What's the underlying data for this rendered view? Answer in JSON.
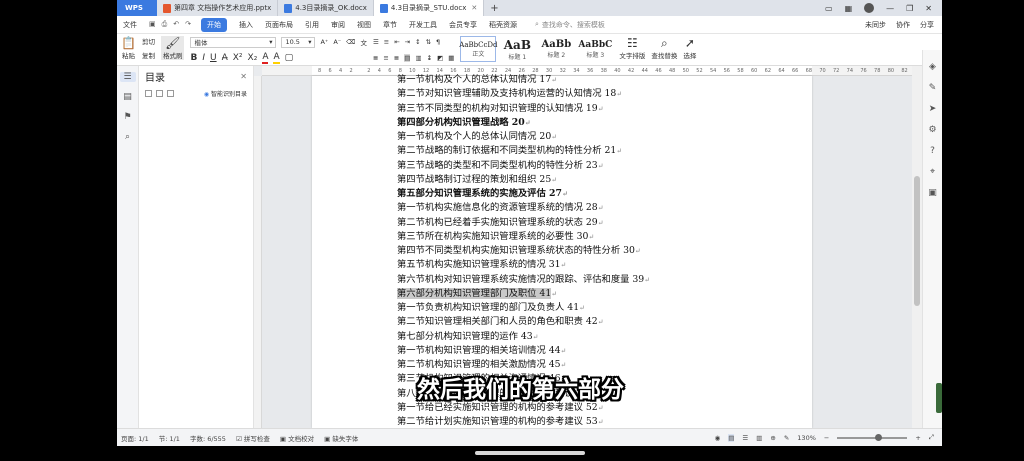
{
  "titlebar": {
    "app": "WPS",
    "tabs": [
      {
        "label": "第四章 文档操作艺术应用.pptx",
        "type": "ppt"
      },
      {
        "label": "4.3目录摘录_OK.docx",
        "type": "doc"
      },
      {
        "label": "4.3目录摘录_STU.docx",
        "type": "doc",
        "active": true
      }
    ],
    "plus": "+"
  },
  "menubar": {
    "file": "文件",
    "items": [
      "开始",
      "插入",
      "页面布局",
      "引用",
      "审阅",
      "视图",
      "章节",
      "开发工具",
      "会员专享",
      "稻壳资源"
    ],
    "active_index": 0,
    "search_placeholder": "查找命令、搜索模板",
    "right": [
      "未同步",
      "协作",
      "分享"
    ]
  },
  "toolbar": {
    "paste": "粘贴",
    "cut": "剪切",
    "copy": "复制",
    "format_painter": "格式刷",
    "font": "楷体",
    "size": "10.5",
    "bold": "B",
    "italic": "I",
    "underline": "U",
    "styles": [
      {
        "sample": "AaBbCcDd",
        "name": "正文"
      },
      {
        "sample": "AaB",
        "name": "标题 1"
      },
      {
        "sample": "AaBb",
        "name": "标题 2"
      },
      {
        "sample": "AaBbC",
        "name": "标题 3"
      }
    ],
    "text_layout": "文字排版",
    "find_replace": "查找替换",
    "select": "选择"
  },
  "navpane": {
    "title": "目录",
    "smart": "智能识别目录"
  },
  "ruler": [
    "8",
    "6",
    "4",
    "2",
    "",
    "2",
    "4",
    "6",
    "8",
    "10",
    "12",
    "14",
    "16",
    "18",
    "20",
    "22",
    "24",
    "26",
    "28",
    "30",
    "32",
    "34",
    "36",
    "38",
    "40",
    "42",
    "44",
    "46",
    "48",
    "50",
    "52",
    "54",
    "56",
    "58",
    "60",
    "62",
    "64",
    "66",
    "68",
    "70",
    "72",
    "74",
    "76",
    "78",
    "80",
    "82",
    "84",
    "86",
    "88",
    "90",
    "92",
    "94",
    "96",
    "98",
    "100",
    "102",
    "104"
  ],
  "document": {
    "lines": [
      {
        "text": "第一节机构及个人的总体认知情况 17",
        "bold": false
      },
      {
        "text": "第二节对知识管理辅助及支持机构运营的认知情况 18",
        "bold": false
      },
      {
        "text": "第三节不同类型的机构对知识管理的认知情况 19",
        "bold": false
      },
      {
        "text": "第四部分机构知识管理战略 20",
        "bold": true
      },
      {
        "text": "第一节机构及个人的总体认同情况 20",
        "bold": false
      },
      {
        "text": "第二节战略的制订依据和不同类型机构的特性分析 21",
        "bold": false
      },
      {
        "text": "第三节战略的类型和不同类型机构的特性分析 23",
        "bold": false
      },
      {
        "text": "第四节战略制订过程的策划和组织 25",
        "bold": false
      },
      {
        "text": "第五部分知识管理系统的实施及评估 27",
        "bold": true
      },
      {
        "text": "第一节机构实施信息化的资源管理系统的情况 28",
        "bold": false
      },
      {
        "text": "第二节机构已经着手实施知识管理系统的状态 29",
        "bold": false
      },
      {
        "text": "第三节所在机构实施知识管理系统的必要性 30",
        "bold": false
      },
      {
        "text": "第四节不同类型机构实施知识管理系统状态的特性分析 30",
        "bold": false
      },
      {
        "text": "第五节机构实施知识管理系统的情况 31",
        "bold": false
      },
      {
        "text": "第六节机构对知识管理系统实施情况的跟踪、评估和度量 39",
        "bold": false
      },
      {
        "text": "第六部分机构知识管理部门及职位 41",
        "bold": false,
        "highlight": true
      },
      {
        "text": "第一节负责机构知识管理的部门及负责人 41",
        "bold": false
      },
      {
        "text": "第二节知识管理相关部门和人员的角色和职责 42",
        "bold": false
      },
      {
        "text": "第七部分机构知识管理的运作 43",
        "bold": false
      },
      {
        "text": "第一节机构知识管理的相关培训情况 44",
        "bold": false
      },
      {
        "text": "第二节机构知识管理的相关激励情况 45",
        "bold": false
      },
      {
        "text": "第三节机构知识管理的相关沟通情况 46",
        "bold": false
      },
      {
        "text": "第八部分给实施知识管理的机构的参考建议 52",
        "bold": false
      },
      {
        "text": "第一节给已经实施知识管理的机构的参考建议 52",
        "bold": false
      },
      {
        "text": "第二节给计划实施知识管理的机构的参考建议 53",
        "bold": false
      }
    ]
  },
  "subtitle": "然后我们的第六部分",
  "statusbar": {
    "page": "页面: 1/1",
    "section": "节: 1/1",
    "words": "字数: 6/555",
    "spell": "拼写检查",
    "proof": "文档校对",
    "font_missing": "缺失字体",
    "zoom": "130%"
  }
}
